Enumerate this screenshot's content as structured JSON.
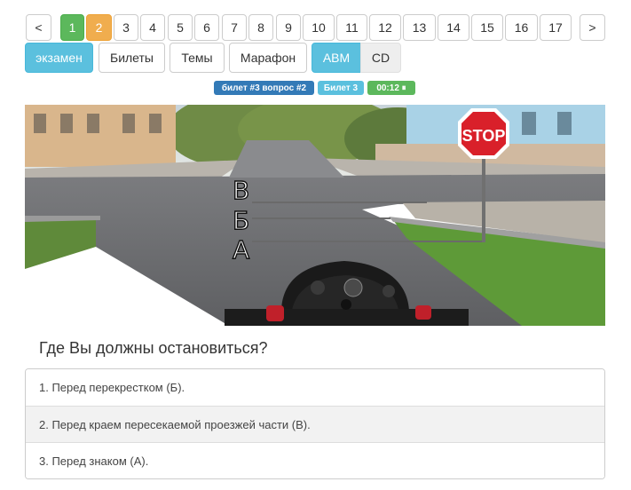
{
  "pager": {
    "prev": "<",
    "next": ">",
    "items": [
      "1",
      "2",
      "3",
      "4",
      "5",
      "6",
      "7",
      "8",
      "9",
      "10",
      "11",
      "12",
      "13",
      "14",
      "15",
      "16",
      "17"
    ]
  },
  "modes": {
    "exam": "экзамен",
    "tickets": "Билеты",
    "topics": "Темы",
    "marathon": "Марафон",
    "cat_abm": "ABM",
    "cat_cd": "CD"
  },
  "badges": {
    "question_ref": "билет #3 вопрос #2",
    "ticket": "Билет 3",
    "timer": "00:12 ⏸"
  },
  "scene": {
    "sign_text": "STOP",
    "label_v": "В",
    "label_b": "Б",
    "label_a": "А"
  },
  "question": "Где Вы должны остановиться?",
  "answers": [
    "1. Перед перекрестком (Б).",
    "2. Перед краем пересекаемой проезжей части (В).",
    "3. Перед знаком (А)."
  ],
  "colors": {
    "correct": "#5cb85c",
    "current": "#f0ad4e",
    "active_mode": "#5bc0de",
    "badge_blue": "#337ab7",
    "badge_info": "#5bc0de",
    "badge_green": "#5cb85c",
    "stop_red": "#d9202a"
  }
}
